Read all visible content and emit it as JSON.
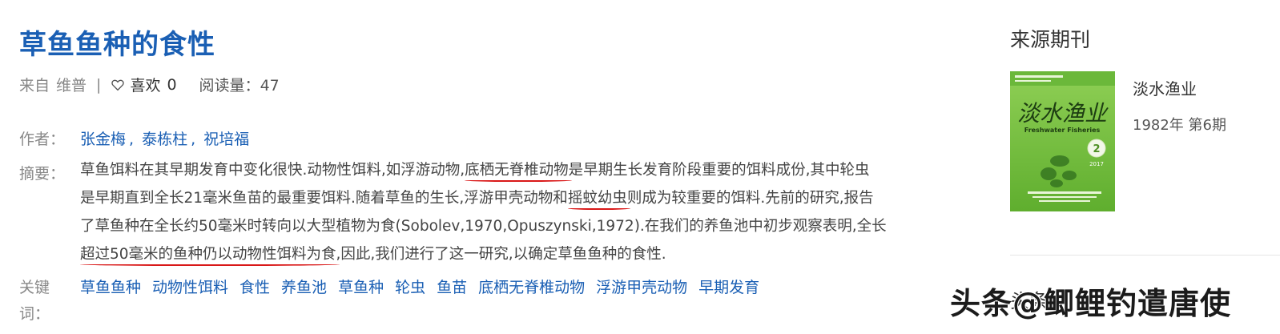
{
  "article": {
    "title": "草鱼鱼种的食性",
    "source_prefix": "来自",
    "source": "维普",
    "separator": "|",
    "like_label": "喜欢",
    "like_count": "0",
    "read_label": "阅读量：",
    "read_count": "47",
    "authors_label": "作者：",
    "authors": [
      "张金梅",
      "泰栋柱",
      "祝培福"
    ],
    "abstract_label": "摘要：",
    "abstract_lines": [
      [
        "草鱼饵料在其早期发育中变化很快.动物性饵料,如浮游动物,",
        "底栖无脊椎动物",
        "是早期生长发育阶段重要的饵料成份,其中轮虫"
      ],
      [
        "是早期直到全长21毫米鱼苗的最重要饵料.随着草鱼的生长,浮游甲壳动物和",
        "摇蚊幼虫",
        "则成为较重要的饵料.先前的研究,报告"
      ],
      [
        "了草鱼种在全长约50毫米时转向以大型植物为食(Sobolev,1970,Opuszynski,1972).在我们的养鱼池中初步观察表明,全长",
        "",
        ""
      ],
      [
        "",
        "超过50毫米的鱼种仍以动物性饵料为食",
        ",因此,我们进行了这一研究,以确定草鱼鱼种的食性."
      ]
    ],
    "keywords_label": "关键词：",
    "keywords": [
      "草鱼鱼种",
      "动物性饵料",
      "食性",
      "养鱼池",
      "草鱼种",
      "轮虫",
      "鱼苗",
      "底栖无脊椎动物",
      "浮游甲壳动物",
      "早期发育"
    ]
  },
  "sidebar": {
    "section_title": "来源期刊",
    "journal_name": "淡水渔业",
    "issue": "1982年 第6期",
    "cover": {
      "title": "淡水渔业",
      "subtitle": "Freshwater Fisheries",
      "issue_badge": "2",
      "year": "2017"
    },
    "partial_text": "头条"
  },
  "watermark": "头条@鲫鲤钓遣唐使",
  "colors": {
    "link": "#1a5fb4",
    "underline": "#d91818",
    "cover_green": "#7dc242"
  }
}
